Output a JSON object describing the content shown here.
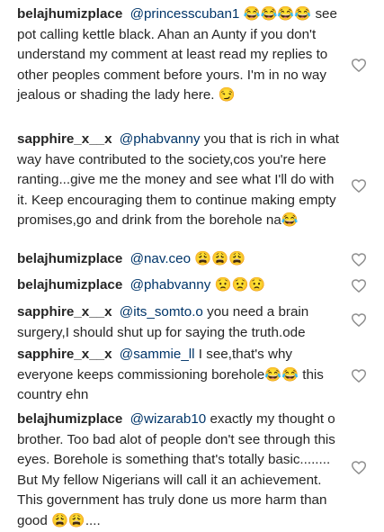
{
  "comments": [
    {
      "username": "belajhumizplace",
      "mention": "@princesscuban1",
      "text": "😂😂😂😂 see pot calling kettle black. Ahan an Aunty if you don't understand my comment at least read my replies to other peoples comment before yours. I'm in no way jealous or shading the lady here. 😏",
      "like_icon": "heart-outline-icon"
    },
    {
      "username": "sapphire_x__x",
      "mention": "@phabvanny",
      "text": "you that is rich in what way have contributed to the society,cos you're here ranting...give me the money and see what I'll do with it. Keep encouraging them to continue making empty promises,go and drink from the borehole na😂",
      "like_icon": "heart-outline-icon"
    },
    {
      "username": "belajhumizplace",
      "mention": "@nav.ceo",
      "text": "😩😩😩",
      "like_icon": "heart-outline-icon"
    },
    {
      "username": "belajhumizplace",
      "mention": "@phabvanny",
      "text": "😟😟😟",
      "like_icon": "heart-outline-icon"
    },
    {
      "username": "sapphire_x__x",
      "mention": "@its_somto.o",
      "text": "you need a brain surgery,I should shut up for saying the truth.ode",
      "like_icon": "heart-outline-icon"
    },
    {
      "username": "sapphire_x__x",
      "mention": "@sammie_ll",
      "text": "I see,that's why everyone keeps commissioning borehole😂😂 this country ehn",
      "like_icon": "heart-outline-icon"
    },
    {
      "username": "belajhumizplace",
      "mention": "@wizarab10",
      "text": "exactly my thought o brother. Too bad alot of people don't see through this eyes. Borehole is something that's totally basic........ But My fellow Nigerians will call it an achievement. This government has truly done us more harm than good 😩😩....",
      "like_icon": "heart-outline-icon"
    }
  ]
}
